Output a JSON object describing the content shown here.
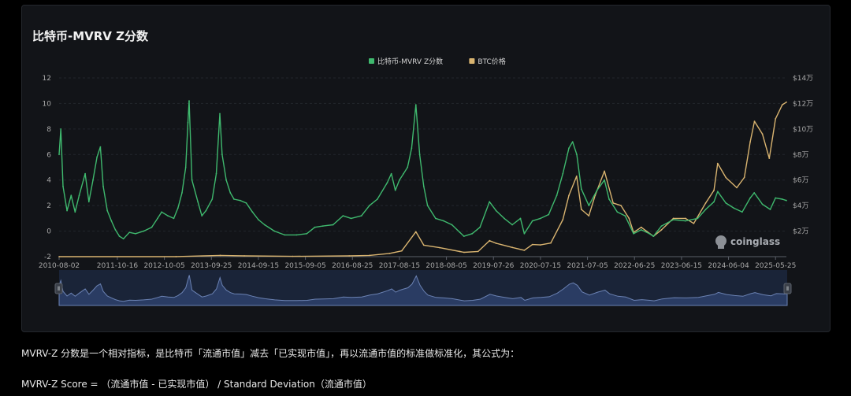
{
  "title": "比特币-MVRV Z分数",
  "description": {
    "line1": "MVRV-Z 分数是一个相对指标，是比特币「流通市值」减去「已实现市值」，再以流通市值的标准做标准化，其公式为：",
    "line2": "MVRV-Z Score = （流通市值 - 已实现市值） / Standard Deviation（流通市值）"
  },
  "watermark": "coinglass",
  "colors": {
    "background": "#000000",
    "card": "#121418",
    "mvrv_line": "#3fb96e",
    "btc_line": "#d9b470",
    "navigator_fill": "#2a3c63",
    "navigator_line": "#6b82b3"
  },
  "chart_data": {
    "type": "line",
    "title": "比特币-MVRV Z分数",
    "legend_position": "top-center",
    "grid": true,
    "x_ticks": [
      "2010-08-02",
      "2011-10-16",
      "2012-10-05",
      "2013-09-25",
      "2014-09-15",
      "2015-09-05",
      "2016-08-25",
      "2017-08-15",
      "2018-08-05",
      "2019-07-26",
      "2020-07-15",
      "2021-07-05",
      "2022-06-25",
      "2023-06-15",
      "2024-06-04",
      "2025-05-25"
    ],
    "y_left": {
      "ticks": [
        "-2",
        "0",
        "2",
        "4",
        "6",
        "8",
        "10",
        "12"
      ],
      "range": [
        -2,
        12
      ]
    },
    "y_right": {
      "ticks": [
        "$2万",
        "$4万",
        "$6万",
        "$8万",
        "$10万",
        "$12万",
        "$14万"
      ],
      "range_usd": [
        0,
        140000
      ]
    },
    "x_range": [
      "2010-08-02",
      "2025-08-15"
    ],
    "series": [
      {
        "name": "比特币-MVRV Z分数",
        "color": "#3fb96e",
        "axis": "left",
        "points": [
          [
            "2010-08-02",
            6.0
          ],
          [
            "2010-08-15",
            8.0
          ],
          [
            "2010-09-01",
            3.5
          ],
          [
            "2010-10-01",
            1.6
          ],
          [
            "2010-11-01",
            2.8
          ],
          [
            "2010-12-01",
            1.5
          ],
          [
            "2011-01-01",
            2.8
          ],
          [
            "2011-02-15",
            4.5
          ],
          [
            "2011-03-15",
            2.3
          ],
          [
            "2011-04-15",
            4.0
          ],
          [
            "2011-05-15",
            5.8
          ],
          [
            "2011-06-10",
            6.6
          ],
          [
            "2011-07-01",
            3.5
          ],
          [
            "2011-08-01",
            1.6
          ],
          [
            "2011-09-01",
            0.8
          ],
          [
            "2011-10-01",
            0.1
          ],
          [
            "2011-11-01",
            -0.4
          ],
          [
            "2011-12-01",
            -0.6
          ],
          [
            "2012-01-15",
            -0.1
          ],
          [
            "2012-03-01",
            -0.2
          ],
          [
            "2012-05-01",
            0.0
          ],
          [
            "2012-07-01",
            0.3
          ],
          [
            "2012-08-15",
            1.0
          ],
          [
            "2012-09-15",
            1.5
          ],
          [
            "2012-11-01",
            1.2
          ],
          [
            "2012-12-15",
            1.0
          ],
          [
            "2013-01-15",
            1.8
          ],
          [
            "2013-02-15",
            3.0
          ],
          [
            "2013-03-15",
            5.0
          ],
          [
            "2013-04-01",
            8.5
          ],
          [
            "2013-04-10",
            10.2
          ],
          [
            "2013-05-01",
            4.0
          ],
          [
            "2013-06-15",
            2.3
          ],
          [
            "2013-07-15",
            1.2
          ],
          [
            "2013-08-15",
            1.6
          ],
          [
            "2013-10-01",
            2.5
          ],
          [
            "2013-11-01",
            4.5
          ],
          [
            "2013-11-28",
            9.2
          ],
          [
            "2013-12-15",
            6.0
          ],
          [
            "2014-01-15",
            4.0
          ],
          [
            "2014-02-15",
            3.0
          ],
          [
            "2014-03-15",
            2.5
          ],
          [
            "2014-05-01",
            2.4
          ],
          [
            "2014-06-15",
            2.2
          ],
          [
            "2014-08-01",
            1.5
          ],
          [
            "2014-09-15",
            0.9
          ],
          [
            "2014-11-01",
            0.5
          ],
          [
            "2015-01-15",
            0.0
          ],
          [
            "2015-04-01",
            -0.3
          ],
          [
            "2015-07-01",
            -0.3
          ],
          [
            "2015-09-15",
            -0.2
          ],
          [
            "2015-11-15",
            0.3
          ],
          [
            "2016-01-15",
            0.4
          ],
          [
            "2016-04-01",
            0.5
          ],
          [
            "2016-06-15",
            1.2
          ],
          [
            "2016-08-15",
            1.0
          ],
          [
            "2016-11-01",
            1.2
          ],
          [
            "2017-01-01",
            2.0
          ],
          [
            "2017-03-01",
            2.5
          ],
          [
            "2017-05-15",
            3.8
          ],
          [
            "2017-06-15",
            4.5
          ],
          [
            "2017-07-15",
            3.2
          ],
          [
            "2017-08-15",
            4.0
          ],
          [
            "2017-09-15",
            4.5
          ],
          [
            "2017-10-15",
            5.0
          ],
          [
            "2017-11-15",
            6.5
          ],
          [
            "2017-12-17",
            9.9
          ],
          [
            "2018-01-15",
            6.0
          ],
          [
            "2018-02-15",
            3.5
          ],
          [
            "2018-03-15",
            2.0
          ],
          [
            "2018-05-15",
            1.0
          ],
          [
            "2018-07-15",
            0.8
          ],
          [
            "2018-09-15",
            0.5
          ],
          [
            "2018-11-15",
            -0.1
          ],
          [
            "2018-12-15",
            -0.4
          ],
          [
            "2019-02-15",
            -0.2
          ],
          [
            "2019-04-15",
            0.3
          ],
          [
            "2019-06-26",
            2.3
          ],
          [
            "2019-08-15",
            1.6
          ],
          [
            "2019-10-15",
            1.0
          ],
          [
            "2019-12-15",
            0.5
          ],
          [
            "2020-02-15",
            1.0
          ],
          [
            "2020-03-15",
            -0.2
          ],
          [
            "2020-05-15",
            0.8
          ],
          [
            "2020-07-15",
            1.0
          ],
          [
            "2020-09-15",
            1.3
          ],
          [
            "2020-11-15",
            2.8
          ],
          [
            "2020-12-31",
            4.5
          ],
          [
            "2021-02-15",
            6.5
          ],
          [
            "2021-03-15",
            7.0
          ],
          [
            "2021-04-15",
            6.0
          ],
          [
            "2021-05-20",
            3.3
          ],
          [
            "2021-07-15",
            2.0
          ],
          [
            "2021-09-15",
            3.2
          ],
          [
            "2021-11-10",
            4.0
          ],
          [
            "2021-12-15",
            2.5
          ],
          [
            "2022-02-15",
            1.5
          ],
          [
            "2022-04-15",
            1.2
          ],
          [
            "2022-06-18",
            -0.2
          ],
          [
            "2022-08-15",
            0.1
          ],
          [
            "2022-10-15",
            -0.2
          ],
          [
            "2022-11-15",
            -0.4
          ],
          [
            "2023-01-15",
            0.4
          ],
          [
            "2023-04-15",
            0.9
          ],
          [
            "2023-07-15",
            0.8
          ],
          [
            "2023-10-15",
            1.0
          ],
          [
            "2023-12-15",
            1.7
          ],
          [
            "2024-02-15",
            2.3
          ],
          [
            "2024-03-14",
            3.1
          ],
          [
            "2024-05-15",
            2.2
          ],
          [
            "2024-07-15",
            1.8
          ],
          [
            "2024-09-15",
            1.5
          ],
          [
            "2024-11-15",
            2.6
          ],
          [
            "2024-12-15",
            3.0
          ],
          [
            "2025-02-15",
            2.1
          ],
          [
            "2025-04-15",
            1.7
          ],
          [
            "2025-05-25",
            2.6
          ],
          [
            "2025-07-15",
            2.5
          ],
          [
            "2025-08-15",
            2.4
          ]
        ]
      },
      {
        "name": "BTC价格",
        "color": "#d9b470",
        "axis": "right",
        "points": [
          [
            "2010-08-02",
            0
          ],
          [
            "2013-01-01",
            0
          ],
          [
            "2013-12-01",
            1000
          ],
          [
            "2014-06-01",
            600
          ],
          [
            "2015-06-01",
            250
          ],
          [
            "2016-08-01",
            600
          ],
          [
            "2017-01-01",
            1000
          ],
          [
            "2017-06-01",
            2500
          ],
          [
            "2017-09-01",
            4500
          ],
          [
            "2017-12-17",
            19500
          ],
          [
            "2018-02-15",
            9000
          ],
          [
            "2018-06-15",
            7000
          ],
          [
            "2018-11-15",
            4000
          ],
          [
            "2018-12-15",
            3400
          ],
          [
            "2019-04-01",
            4100
          ],
          [
            "2019-06-26",
            12500
          ],
          [
            "2019-08-15",
            10500
          ],
          [
            "2019-12-15",
            7200
          ],
          [
            "2020-03-15",
            5000
          ],
          [
            "2020-05-15",
            9500
          ],
          [
            "2020-07-15",
            9200
          ],
          [
            "2020-10-01",
            10700
          ],
          [
            "2020-12-31",
            29000
          ],
          [
            "2021-02-15",
            48000
          ],
          [
            "2021-04-14",
            63000
          ],
          [
            "2021-05-20",
            37000
          ],
          [
            "2021-07-15",
            32000
          ],
          [
            "2021-09-01",
            48000
          ],
          [
            "2021-11-10",
            67000
          ],
          [
            "2022-01-15",
            42000
          ],
          [
            "2022-03-15",
            40000
          ],
          [
            "2022-05-15",
            30000
          ],
          [
            "2022-06-18",
            19000
          ],
          [
            "2022-08-15",
            23000
          ],
          [
            "2022-11-15",
            16000
          ],
          [
            "2023-01-15",
            21000
          ],
          [
            "2023-04-15",
            30000
          ],
          [
            "2023-07-15",
            30000
          ],
          [
            "2023-09-15",
            26000
          ],
          [
            "2023-12-15",
            42000
          ],
          [
            "2024-02-15",
            52000
          ],
          [
            "2024-03-14",
            73000
          ],
          [
            "2024-05-15",
            62000
          ],
          [
            "2024-08-05",
            54000
          ],
          [
            "2024-10-01",
            62000
          ],
          [
            "2024-11-15",
            90000
          ],
          [
            "2024-12-17",
            106000
          ],
          [
            "2025-02-15",
            96000
          ],
          [
            "2025-04-08",
            77000
          ],
          [
            "2025-05-25",
            108000
          ],
          [
            "2025-07-15",
            119000
          ],
          [
            "2025-08-15",
            121000
          ]
        ]
      }
    ]
  }
}
